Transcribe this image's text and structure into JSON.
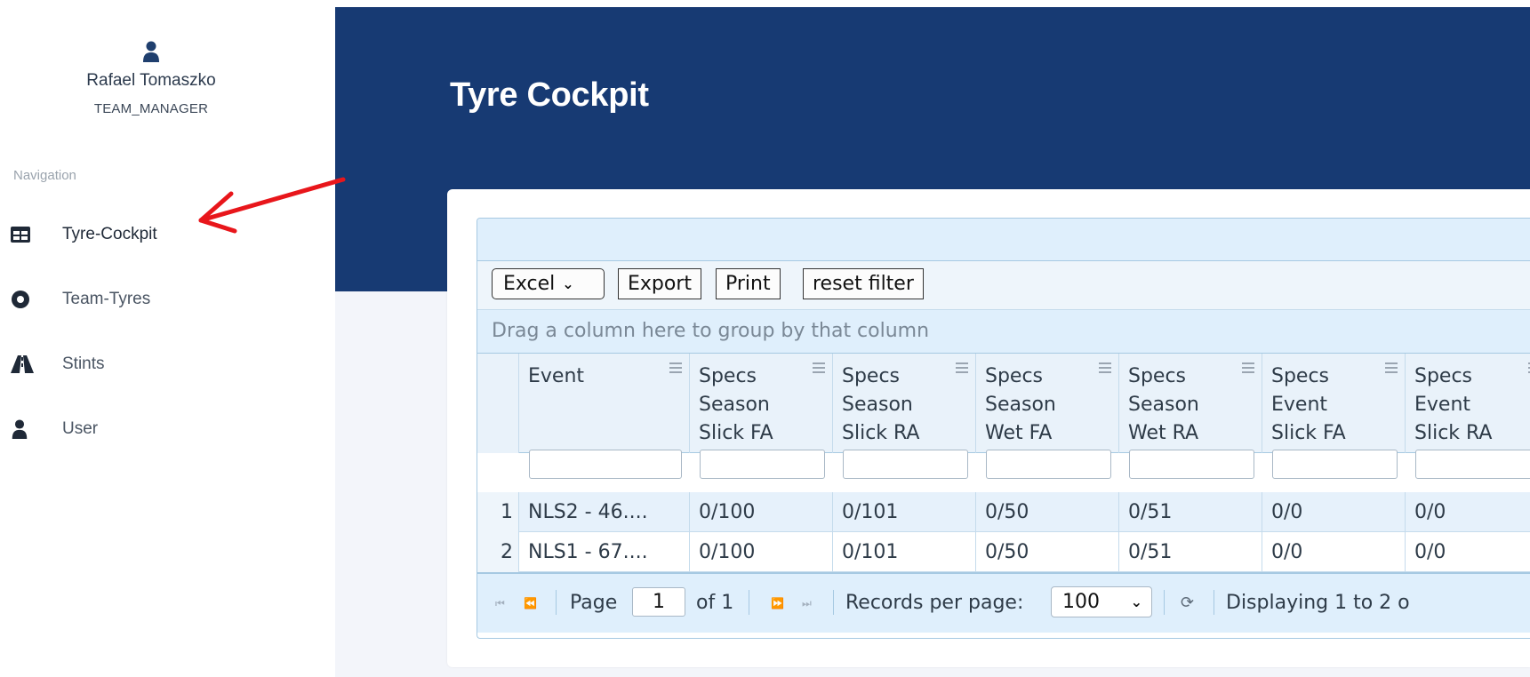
{
  "user": {
    "name": "Rafael Tomaszko",
    "role": "TEAM_MANAGER",
    "icon": "user-icon"
  },
  "nav": {
    "caption": "Navigation",
    "items": [
      {
        "label": "Tyre-Cockpit",
        "icon": "table-icon",
        "active": true
      },
      {
        "label": "Team-Tyres",
        "icon": "tyre-icon"
      },
      {
        "label": "Stints",
        "icon": "road-icon"
      },
      {
        "label": "User",
        "icon": "user-icon"
      }
    ]
  },
  "page": {
    "title": "Tyre Cockpit"
  },
  "toolbar": {
    "format_selected": "Excel",
    "export_label": "Export",
    "print_label": "Print",
    "reset_label": "reset filter"
  },
  "grid": {
    "group_hint": "Drag a column here to group by that column",
    "columns": [
      "Event",
      "Specs\nSeason\nSlick FA",
      "Specs\nSeason\nSlick RA",
      "Specs\nSeason\nWet FA",
      "Specs\nSeason\nWet RA",
      "Specs\nEvent\nSlick FA",
      "Specs\nEvent\nSlick RA"
    ],
    "rows": [
      {
        "num": "1",
        "cells": [
          "NLS2 - 46....",
          "0/100",
          "0/101",
          "0/50",
          "0/51",
          "0/0",
          "0/0"
        ]
      },
      {
        "num": "2",
        "cells": [
          "NLS1 - 67....",
          "0/100",
          "0/101",
          "0/50",
          "0/51",
          "0/0",
          "0/0"
        ]
      }
    ]
  },
  "pager": {
    "page_label": "Page",
    "page_value": "1",
    "of_label": "of 1",
    "records_label": "Records per page:",
    "records_value": "100",
    "displaying": "Displaying 1 to 2 o"
  },
  "colors": {
    "banner": "#173a73",
    "annotation_arrow": "#e8161b"
  }
}
